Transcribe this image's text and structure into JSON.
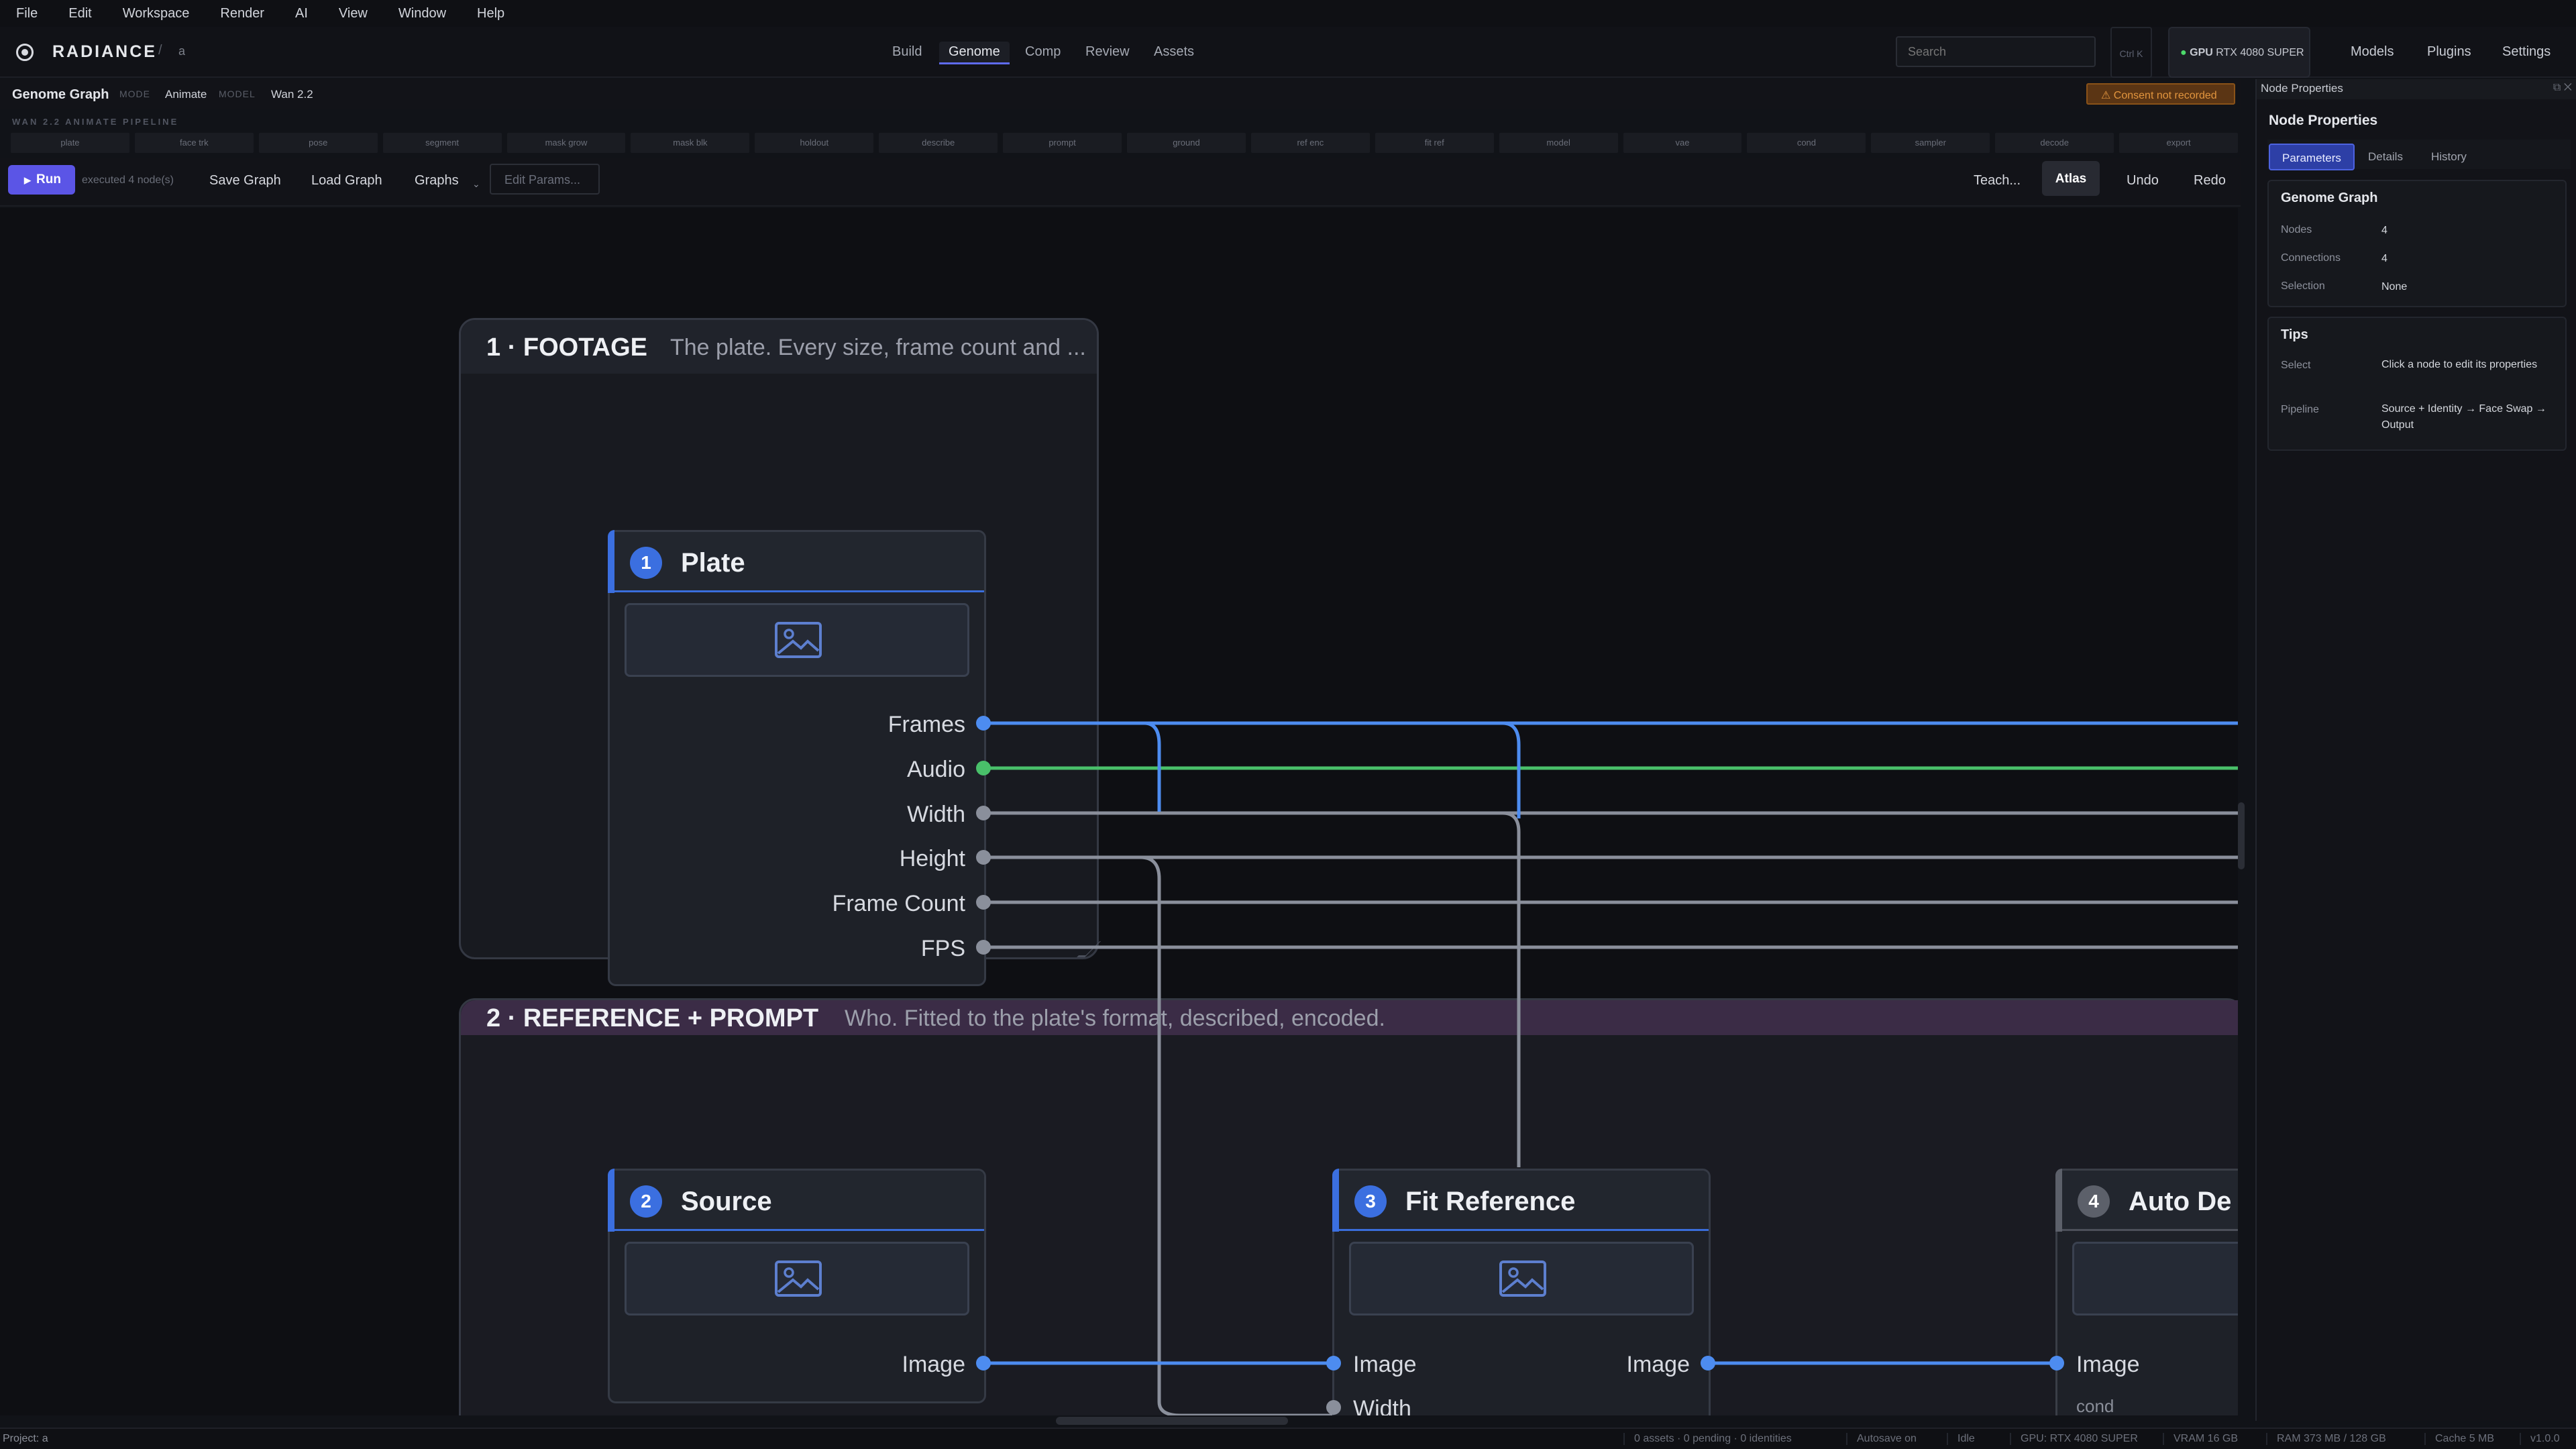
{
  "menu": [
    "File",
    "Edit",
    "Workspace",
    "Render",
    "AI",
    "View",
    "Window",
    "Help"
  ],
  "header": {
    "logo_text": "RADIANCE",
    "crumb_sep": "/",
    "project": "a",
    "tabs": [
      "Build",
      "Genome",
      "Comp",
      "Review",
      "Assets"
    ],
    "active_tab": "Genome",
    "search_placeholder": "Search",
    "shortcut": "Ctrl K",
    "gpu_label": "GPU",
    "gpu_name": "RTX 4080 SUPER",
    "links": [
      "Models",
      "Plugins",
      "Settings"
    ]
  },
  "graph_bar": {
    "title": "Genome Graph",
    "mode_label": "MODE",
    "mode_value": "Animate",
    "model_label": "MODEL",
    "model_value": "Wan 2.2",
    "consent": "Consent not recorded"
  },
  "pipeline": {
    "label": "WAN 2.2 ANIMATE PIPELINE",
    "stages": [
      "plate",
      "face trk",
      "pose",
      "segment",
      "mask grow",
      "mask blk",
      "holdout",
      "describe",
      "prompt",
      "ground",
      "ref enc",
      "fit ref",
      "model",
      "vae",
      "cond",
      "sampler",
      "decode",
      "export"
    ]
  },
  "toolbar": {
    "run": "Run",
    "executed": "executed 4 node(s)",
    "save": "Save Graph",
    "load": "Load Graph",
    "graphs": "Graphs",
    "edit_params": "Edit Params...",
    "teach": "Teach...",
    "atlas": "Atlas",
    "undo": "Undo",
    "redo": "Redo"
  },
  "groups": [
    {
      "title": "1 · FOOTAGE",
      "desc": "The plate. Every size, frame count and ..."
    },
    {
      "title": "2 · REFERENCE + PROMPT",
      "desc": "Who. Fitted to the plate's format, described, encoded."
    }
  ],
  "nodes": {
    "plate": {
      "num": "1",
      "title": "Plate",
      "ports": [
        "Frames",
        "Audio",
        "Width",
        "Height",
        "Frame Count",
        "FPS"
      ]
    },
    "source": {
      "num": "2",
      "title": "Source",
      "ports": [
        "Image"
      ]
    },
    "fit_ref": {
      "num": "3",
      "title": "Fit Reference",
      "inputs": [
        "Image",
        "Width"
      ],
      "outputs": [
        "Image"
      ]
    },
    "auto_de": {
      "num": "4",
      "title": "Auto De",
      "inputs": [
        "Image",
        "cond"
      ]
    }
  },
  "panel": {
    "titlebar": "Node Properties",
    "title": "Node Properties",
    "tabs": [
      "Parameters",
      "Details",
      "History"
    ],
    "graph_card": {
      "title": "Genome Graph",
      "rows": [
        {
          "k": "Nodes",
          "v": "4"
        },
        {
          "k": "Connections",
          "v": "4"
        },
        {
          "k": "Selection",
          "v": "None"
        }
      ]
    },
    "tips_card": {
      "title": "Tips",
      "rows": [
        {
          "k": "Select",
          "v": "Click a node to edit its properties"
        },
        {
          "k": "Pipeline",
          "v": "Source + Identity → Face Swap → Output"
        }
      ]
    }
  },
  "status": {
    "project": "Project: a",
    "items": [
      "0 assets · 0 pending · 0 identities",
      "Autosave on",
      "Idle",
      "GPU: RTX 4080 SUPER",
      "VRAM 16 GB",
      "RAM 373 MB / 128 GB",
      "Cache 5 MB",
      "v1.0.0"
    ]
  },
  "colors": {
    "accent": "#5b55e6",
    "wire_blue": "#4d8cf0",
    "wire_green": "#49c06a",
    "wire_gray": "#8a8f9b",
    "node_badge": "#3b6fe0"
  }
}
